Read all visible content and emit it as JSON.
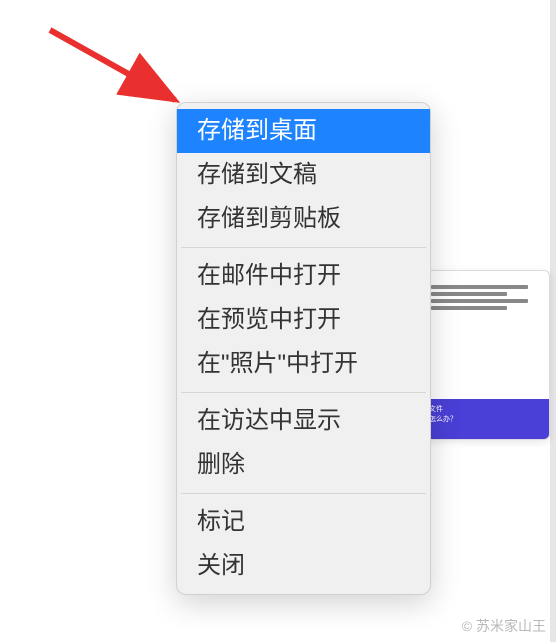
{
  "menu": {
    "items": [
      {
        "label": "存储到桌面",
        "highlighted": true
      },
      {
        "label": "存储到文稿",
        "highlighted": false
      },
      {
        "label": "存储到剪贴板",
        "highlighted": false
      },
      {
        "separator": true
      },
      {
        "label": "在邮件中打开",
        "highlighted": false
      },
      {
        "label": "在预览中打开",
        "highlighted": false
      },
      {
        "label": "在\"照片\"中打开",
        "highlighted": false
      },
      {
        "separator": true
      },
      {
        "label": "在访达中显示",
        "highlighted": false
      },
      {
        "label": "删除",
        "highlighted": false
      },
      {
        "separator": true
      },
      {
        "label": "标记",
        "highlighted": false
      },
      {
        "label": "关闭",
        "highlighted": false
      }
    ]
  },
  "arrow": {
    "color": "#e9302e"
  },
  "thumbnail": {
    "banner_line1": "文件",
    "banner_line2": "怎么办？"
  },
  "watermark": "© 苏米家山王"
}
